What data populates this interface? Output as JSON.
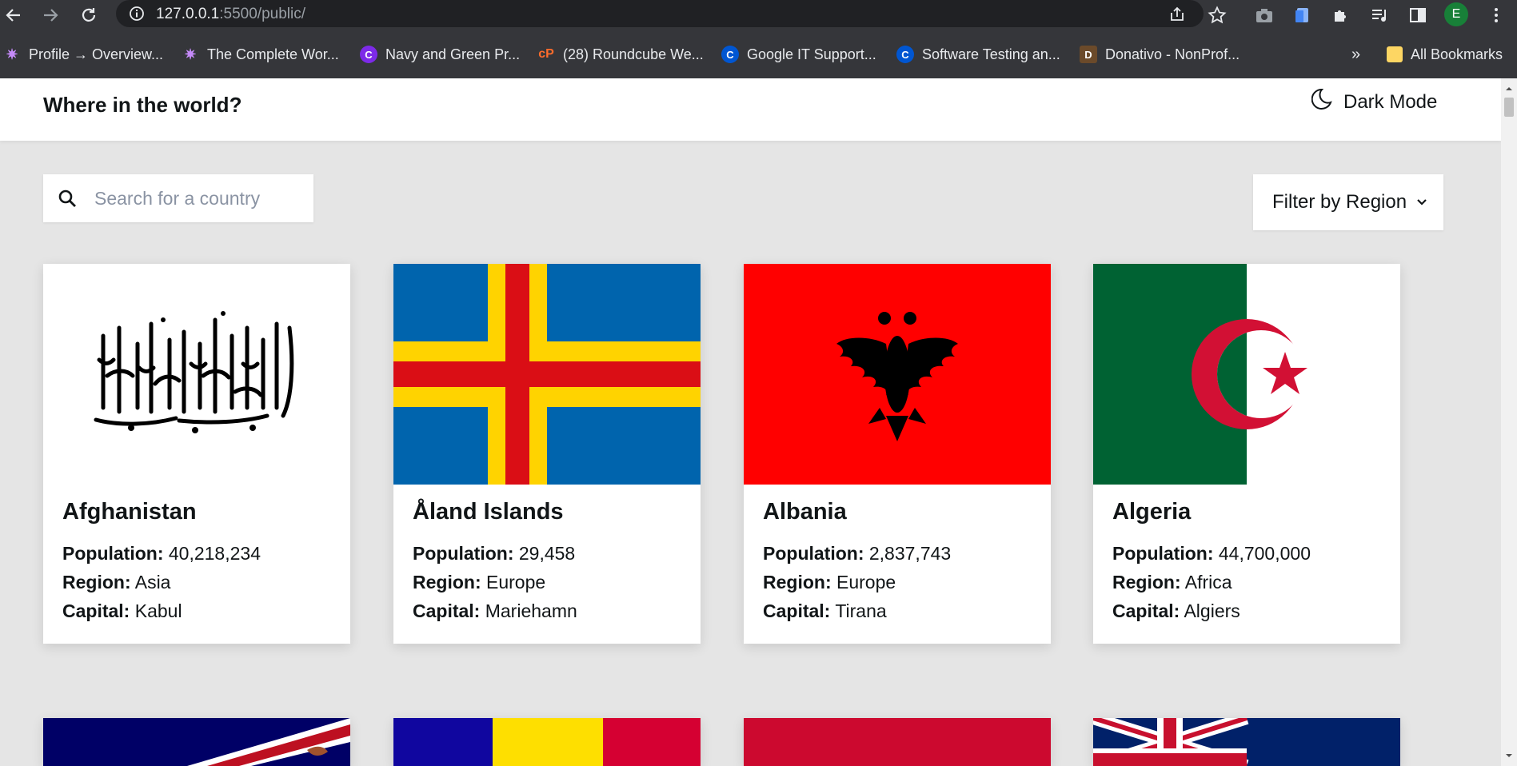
{
  "browser": {
    "url_host": "127.0.0.1",
    "url_path": ":5500/public/",
    "avatar_letter": "E",
    "bookmarks": [
      {
        "label": "Profile → Overview..."
      },
      {
        "label": "The Complete Wor..."
      },
      {
        "label": "Navy and Green Pr..."
      },
      {
        "label": "(28) Roundcube We..."
      },
      {
        "label": "Google IT Support..."
      },
      {
        "label": "Software Testing an..."
      },
      {
        "label": "Donativo - NonProf..."
      }
    ],
    "overflow": "»",
    "all_bookmarks": "All Bookmarks"
  },
  "header": {
    "title": "Where in the world?",
    "dark_mode_label": "Dark Mode"
  },
  "search": {
    "placeholder": "Search for a country",
    "value": ""
  },
  "filter": {
    "label": "Filter by Region"
  },
  "labels": {
    "population": "Population:",
    "region": "Region:",
    "capital": "Capital:"
  },
  "countries": [
    {
      "name": "Afghanistan",
      "population": "40,218,234",
      "region": "Asia",
      "capital": "Kabul",
      "flag_icon": "afghanistan-flag"
    },
    {
      "name": "Åland Islands",
      "population": "29,458",
      "region": "Europe",
      "capital": "Mariehamn",
      "flag_icon": "aland-flag"
    },
    {
      "name": "Albania",
      "population": "2,837,743",
      "region": "Europe",
      "capital": "Tirana",
      "flag_icon": "albania-flag"
    },
    {
      "name": "Algeria",
      "population": "44,700,000",
      "region": "Africa",
      "capital": "Algiers",
      "flag_icon": "algeria-flag"
    }
  ],
  "next_row_flags": [
    "american-samoa-flag",
    "andorra-flag",
    "angola-flag",
    "anguilla-flag"
  ],
  "colors": {
    "page_bg": "#e5e5e5",
    "card_bg": "#ffffff",
    "text": "#111517",
    "chrome_bg": "#35363a"
  }
}
